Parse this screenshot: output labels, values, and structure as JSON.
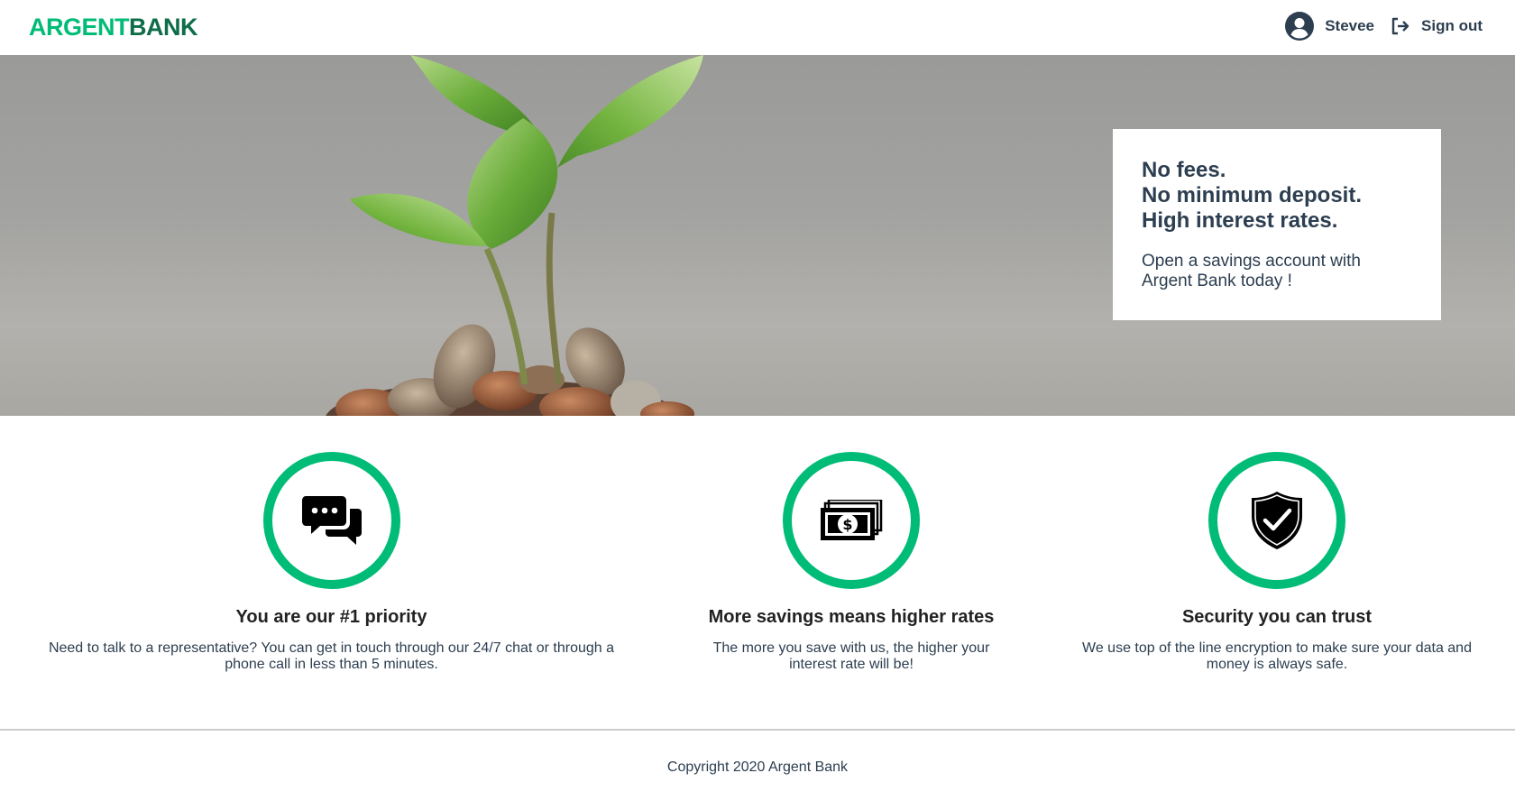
{
  "nav": {
    "logo_argent": "ARGENT",
    "logo_bank": "BANK",
    "user_name": "Stevee",
    "signout_label": "Sign out"
  },
  "hero": {
    "subtitles": [
      "No fees.",
      "No minimum deposit.",
      "High interest rates."
    ],
    "text": "Open a savings account with Argent Bank today !"
  },
  "features": [
    {
      "icon": "chat-icon",
      "title": "You are our #1 priority",
      "text": "Need to talk to a representative? You can get in touch through our 24/7 chat or through a phone call in less than 5 minutes."
    },
    {
      "icon": "money-icon",
      "title": "More savings means higher rates",
      "text": "The more you save with us, the higher your interest rate will be!"
    },
    {
      "icon": "security-icon",
      "title": "Security you can trust",
      "text": "We use top of the line encryption to make sure your data and money is always safe."
    }
  ],
  "footer": {
    "copyright": "Copyright 2020 Argent Bank"
  },
  "colors": {
    "accent": "#00bc77",
    "accent_dark": "#0f6d4a",
    "text": "#2c3e50"
  }
}
